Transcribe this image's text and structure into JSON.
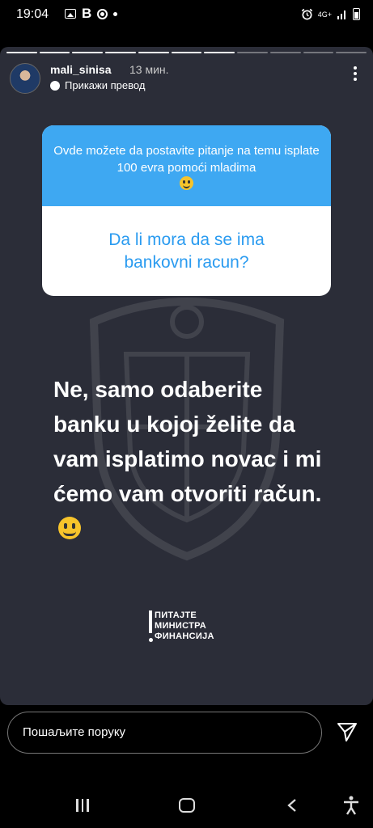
{
  "status_bar": {
    "time": "19:04",
    "network": "4G+",
    "left_icons": [
      "gallery-icon",
      "b-icon",
      "chrome-icon",
      "dot-icon"
    ],
    "right_icons": [
      "alarm-icon",
      "network-icon",
      "signal-icon",
      "battery-icon"
    ]
  },
  "story": {
    "segments_total": 11,
    "segments_done": 7,
    "username": "mali_sinisa",
    "time_ago": "13 мин.",
    "translate_label": "Прикажи превод",
    "question_prompt": "Ovde možete da postavite pitanje na temu isplate 100 evra pomoći mladima",
    "question": "Da li mora da se ima bankovni racun?",
    "answer": "Ne, samo odaberite banku u kojoj želite da vam isplatimo novac i mi ćemo vam otvoriti račun.",
    "logo_lines": [
      "ПИТАЈТЕ",
      "МИНИСТРА",
      "ФИНАНСИЈА"
    ]
  },
  "reply": {
    "placeholder": "Пошаљите поруку"
  },
  "colors": {
    "story_background": "#2b2d38",
    "question_header": "#3ea8f2",
    "question_text": "#2a9bf0"
  }
}
